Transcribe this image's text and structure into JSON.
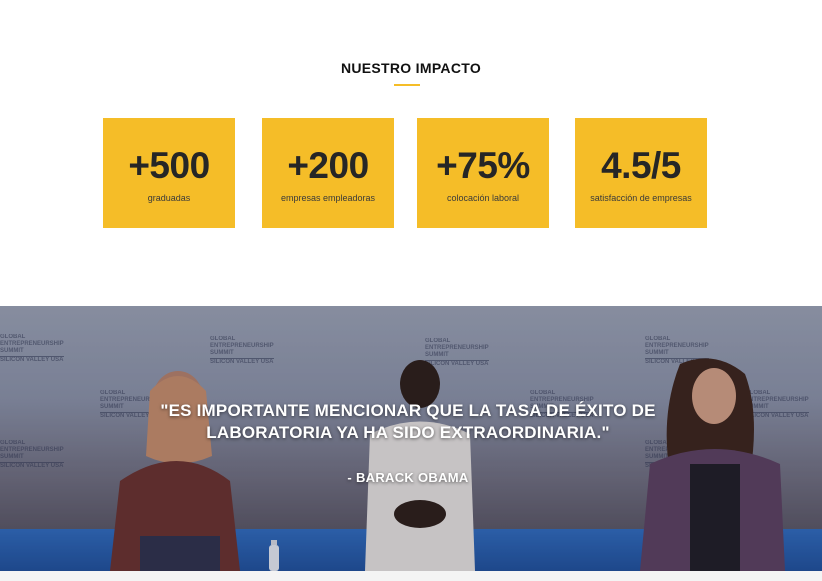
{
  "impact": {
    "title": "NUESTRO IMPACTO",
    "accent_color": "#f5bd28",
    "stats": [
      {
        "value": "+500",
        "label": "graduadas"
      },
      {
        "value": "+200",
        "label": "empresas empleadoras"
      },
      {
        "value": "+75%",
        "label": "colocación laboral"
      },
      {
        "value": "4.5/5",
        "label": "satisfacción de empresas"
      }
    ]
  },
  "hero": {
    "quote": "\"ES IMPORTANTE MENCIONAR QUE LA TASA DE ÉXITO DE LABORATORIA YA HA SIDO EXTRAORDINARIA.\"",
    "author": "- BARACK OBAMA",
    "backdrop_lines": [
      "GLOBAL",
      "ENTREPRENEURSHIP",
      "SUMMIT",
      "SILICON VALLEY USA"
    ]
  }
}
